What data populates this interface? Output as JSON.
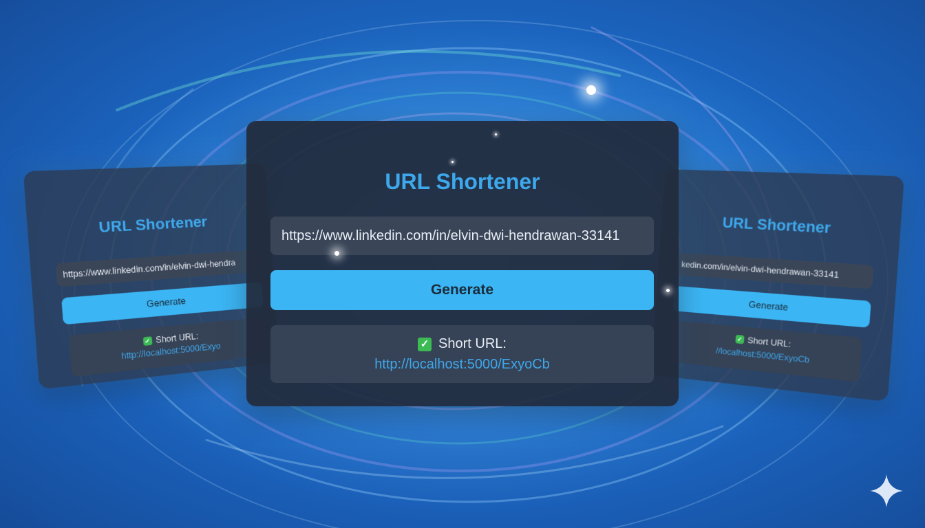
{
  "app": {
    "title": "URL Shortener",
    "url_value": "https://www.linkedin.com/in/elvin-dwi-hendrawan-33141",
    "url_value_left": "https://www.linkedin.com/in/elvin-dwi-hendra",
    "url_value_right": "kedin.com/in/elvin-dwi-hendrawan-33141",
    "generate_label": "Generate",
    "check_glyph": "✓",
    "short_url_label": "Short URL:",
    "short_url": "http://localhost:5000/ExyoCb",
    "short_url_left": "http://localhost:5000/Exyo",
    "short_url_right": "//localhost:5000/ExyoCb"
  },
  "colors": {
    "accent": "#3ea8ec",
    "button": "#3bb5f3",
    "card": "#222c3e",
    "check": "#3cbb55"
  },
  "icons": {
    "check": "check-mark-icon",
    "watermark": "gemini-sparkle-icon"
  }
}
